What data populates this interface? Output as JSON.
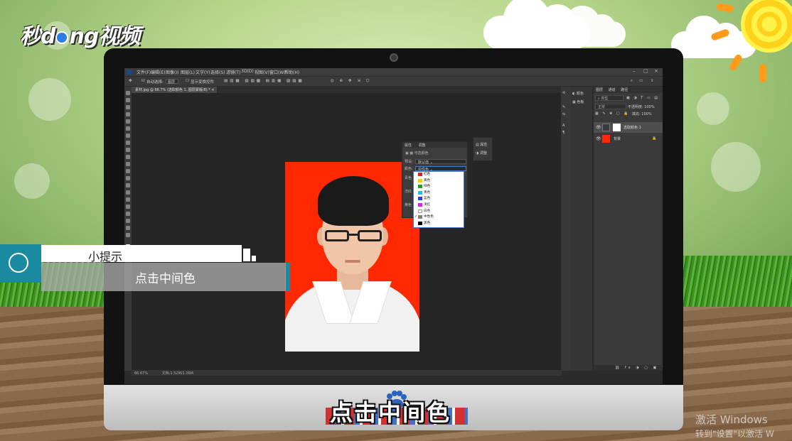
{
  "brand": {
    "logo_text_1": "秒",
    "logo_text_2": "ng视频",
    "logo_text_d": "d"
  },
  "photoshop": {
    "menu": [
      "文件(F)",
      "编辑(E)",
      "图像(I)",
      "图层(L)",
      "文字(Y)",
      "选择(S)",
      "滤镜(T)",
      "3D(D)",
      "视图(V)",
      "窗口(W)",
      "帮助(H)"
    ],
    "options": {
      "auto_select": "自动选择:",
      "auto_select_value": "图层",
      "show_transform": "显示变换控件"
    },
    "document_tab": "素材.jpg @ 66.7% (选取颜色 1, 图层蒙版/8) *",
    "status": {
      "zoom": "66.67%",
      "doc_info": "文档:1.52M/1.36M"
    },
    "properties_panel": {
      "tabs": [
        "属性",
        "调整"
      ],
      "title": "可选颜色",
      "preset_label": "预设:",
      "preset_value": "默认值",
      "colors_label": "颜色:",
      "colors_value": "中性色",
      "row_labels": [
        "青色",
        "洋红",
        "黄色"
      ]
    },
    "mini_panel": {
      "items": [
        "属性",
        "调整"
      ]
    },
    "color_dropdown": {
      "options": [
        {
          "label": "红色",
          "color": "#e02020"
        },
        {
          "label": "黄色",
          "color": "#f0d000"
        },
        {
          "label": "绿色",
          "color": "#20a020"
        },
        {
          "label": "青色",
          "color": "#20c0e0"
        },
        {
          "label": "蓝色",
          "color": "#2040e0"
        },
        {
          "label": "洋红",
          "color": "#e020e0"
        },
        {
          "label": "白色",
          "color": "#ffffff"
        },
        {
          "label": "中性色",
          "color": "#808080"
        },
        {
          "label": "黑色",
          "color": "#000000"
        }
      ],
      "selected": "中性色"
    },
    "mid_panel": {
      "items": [
        "颜色",
        "色板"
      ]
    },
    "layers_panel": {
      "tabs": [
        "图层",
        "通道",
        "路径"
      ],
      "kind": "类型",
      "blend_mode": "正常",
      "opacity_label": "不透明度:",
      "opacity_value": "100%",
      "fill_label": "填充:",
      "fill_value": "100%",
      "layers": [
        {
          "name": "选取颜色 1",
          "selected": true
        },
        {
          "name": "背景",
          "selected": false
        }
      ]
    }
  },
  "tip": {
    "title": "小提示",
    "body": "点击中间色"
  },
  "subtitle": "点击中间色",
  "watermark": {
    "line1": "激活 Windows",
    "line2": "转到\"设置\"以激活 W"
  }
}
